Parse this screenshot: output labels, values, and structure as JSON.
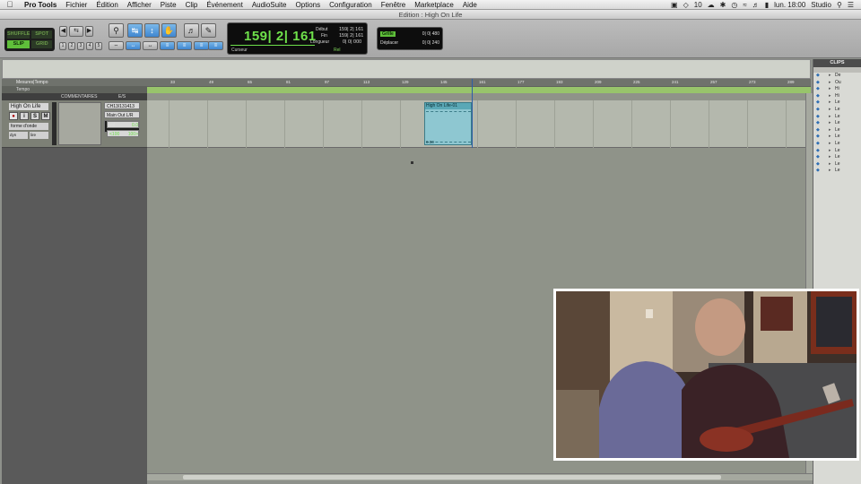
{
  "menubar": {
    "app": "Pro Tools",
    "items": [
      "Fichier",
      "Édition",
      "Afficher",
      "Piste",
      "Clip",
      "Événement",
      "AudioSuite",
      "Options",
      "Configuration",
      "Fenêtre",
      "Marketplace",
      "Aide"
    ],
    "status_num": "10",
    "clock": "lun. 18:00",
    "user": "Studio"
  },
  "window": {
    "title": "Edition : High On Life"
  },
  "modes": [
    "SHUFFLE",
    "SPOT",
    "SLIP",
    "GRID"
  ],
  "zoom_presets": [
    "1",
    "2",
    "3",
    "4",
    "5"
  ],
  "counter": {
    "main": "159| 2| 161",
    "start_label": "Début",
    "end_label": "Fin",
    "length_label": "Longueur",
    "start": "159| 2| 161",
    "end": "159| 2| 161",
    "length": "0| 0| 000",
    "cursor_label": "Curseur",
    "rel_label": "Rel"
  },
  "grid_nudge": {
    "grid_label": "Grille",
    "grid_value": "0| 0| 480",
    "nudge_label": "Déplacer",
    "nudge_value": "0| 0| 240"
  },
  "rulers": {
    "main_label": "Mesures|Tempo",
    "tempo_label": "Tempo",
    "ticks": [
      "33",
      "49",
      "65",
      "81",
      "97",
      "113",
      "129",
      "145",
      "161",
      "177",
      "193",
      "209",
      "225",
      "241",
      "257",
      "273",
      "289"
    ]
  },
  "columns": {
    "comments": "COMMENTAIRES",
    "io": "E/S"
  },
  "track": {
    "name": "High On Life",
    "input": "CH13/131413",
    "output": "Main Out L/R",
    "view": "forme d'onde",
    "mode_a": "dyn",
    "mode_b": "lire",
    "vol_label": "vol",
    "vol_value": "0.0",
    "pan_left": "<100",
    "pan_right": "100>"
  },
  "clip": {
    "name": "High On Life-01",
    "footer": "0.00"
  },
  "clips_panel": {
    "title": "CLIPS",
    "items": [
      "De",
      "Ou",
      "Hi",
      "Hi",
      "Le",
      "Le",
      "Le",
      "Le",
      "Le",
      "Le",
      "Le",
      "Le",
      "Le",
      "Le",
      "Le"
    ]
  }
}
